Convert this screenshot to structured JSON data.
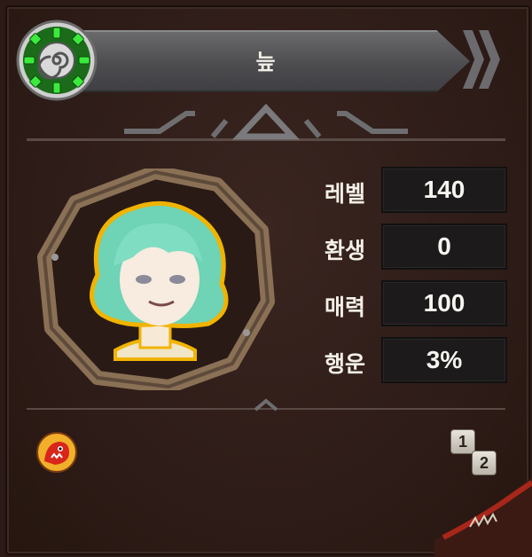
{
  "header": {
    "name": "늪",
    "emblem_icon": "spiral-emblem-icon",
    "emblem_color": "#2bd32b"
  },
  "stats": [
    {
      "label": "레벨",
      "value": "140"
    },
    {
      "label": "환생",
      "value": "0"
    },
    {
      "label": "매력",
      "value": "100"
    },
    {
      "label": "행운",
      "value": "3%"
    }
  ],
  "footer": {
    "pet_icon": "red-monster-icon",
    "page_icon": "page-toggle-icon",
    "page_numbers": [
      "1",
      "2"
    ]
  },
  "colors": {
    "background": "#2e1c18",
    "title_bar": "#55555a",
    "frame": "#8a7055",
    "hair": "#6fd3b5",
    "outline": "#f0b400"
  }
}
